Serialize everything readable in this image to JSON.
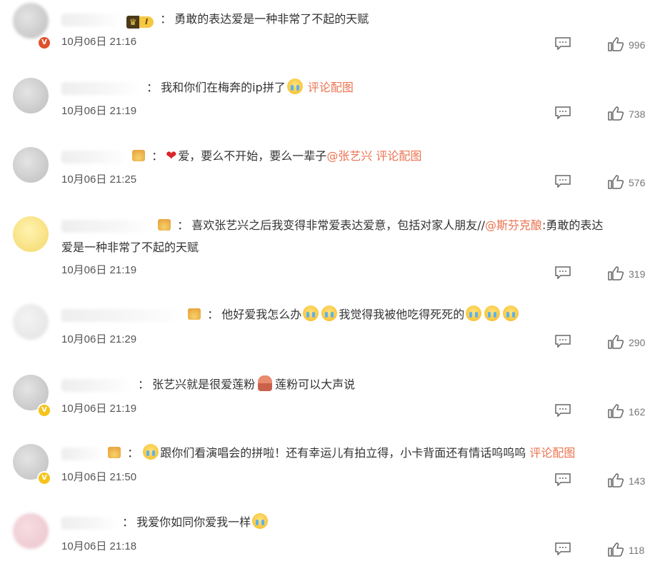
{
  "colors": {
    "link": "#eb7350",
    "text": "#333333",
    "meta": "#555555"
  },
  "icons": {
    "reply": "comment-bubble-icon",
    "like": "thumbs-up-icon"
  },
  "comments": [
    {
      "segments": [
        "勇敢的表达爱是一种非常了不起的天赋"
      ],
      "badge_level": "I",
      "time": "10月06日 21:16",
      "likes": "996"
    },
    {
      "segments": [
        "我和你们在梅奔的ip拼了",
        "评论配图"
      ],
      "time": "10月06日 21:19",
      "likes": "738"
    },
    {
      "segments": [
        "爱，要么不开始，要么一辈子",
        "@张艺兴",
        "评论配图"
      ],
      "time": "10月06日 21:25",
      "likes": "576"
    },
    {
      "segments": [
        "喜欢张艺兴之后我变得非常爱表达爱意，包括对家人朋友//",
        "@斯芬克酿",
        ":勇敢的表达",
        "爱是一种非常了不起的天赋"
      ],
      "time": "10月06日 21:19",
      "likes": "319"
    },
    {
      "segments": [
        "他好爱我怎么办",
        "我觉得我被他吃得死死的"
      ],
      "time": "10月06日 21:29",
      "likes": "290"
    },
    {
      "segments": [
        "张艺兴就是很爱莲粉",
        "莲粉可以大声说"
      ],
      "time": "10月06日 21:19",
      "likes": "162"
    },
    {
      "segments": [
        "跟你们看演唱会的拼啦！还有幸运儿有拍立得，小卡背面还有情话呜呜呜",
        "评论配图"
      ],
      "time": "10月06日 21:50",
      "likes": "143"
    },
    {
      "segments": [
        "我爱你如同你爱我一样"
      ],
      "time": "10月06日 21:18",
      "likes": "118"
    }
  ]
}
